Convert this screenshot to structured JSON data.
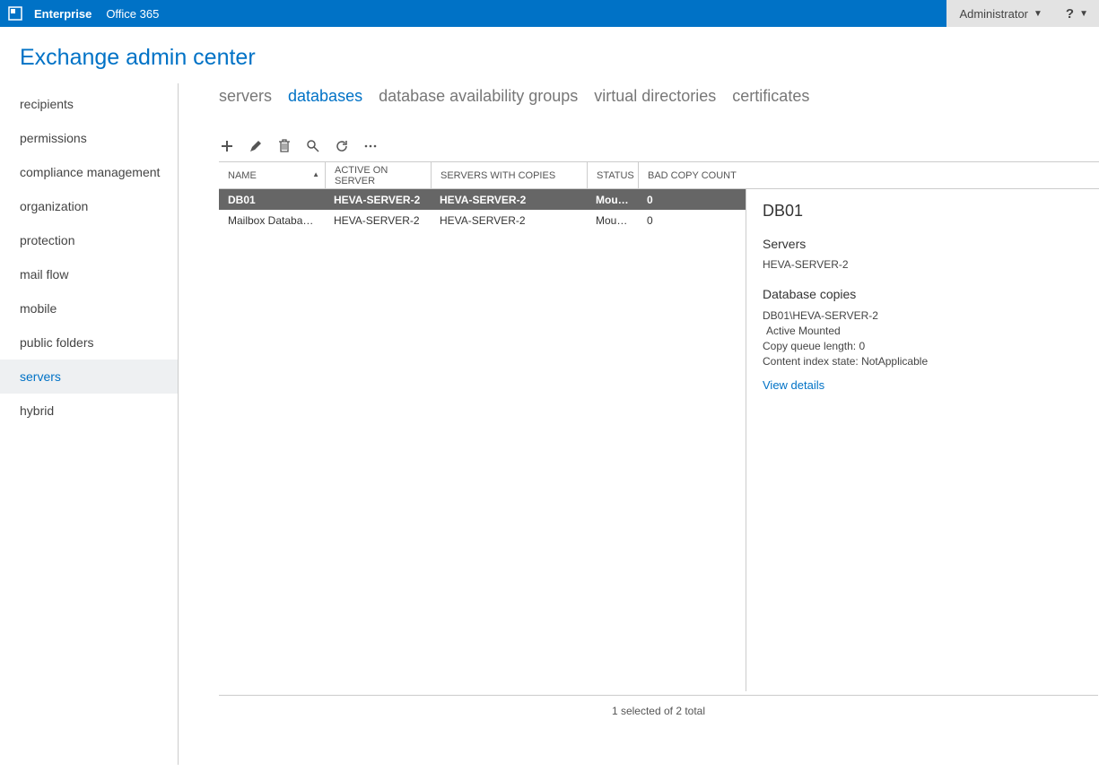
{
  "topbar": {
    "link_enterprise": "Enterprise",
    "link_office365": "Office 365",
    "user_label": "Administrator",
    "help_label": "?"
  },
  "page_title": "Exchange admin center",
  "sidebar": {
    "items": [
      {
        "label": "recipients"
      },
      {
        "label": "permissions"
      },
      {
        "label": "compliance management"
      },
      {
        "label": "organization"
      },
      {
        "label": "protection"
      },
      {
        "label": "mail flow"
      },
      {
        "label": "mobile"
      },
      {
        "label": "public folders"
      },
      {
        "label": "servers"
      },
      {
        "label": "hybrid"
      }
    ]
  },
  "tabs": [
    {
      "label": "servers"
    },
    {
      "label": "databases"
    },
    {
      "label": "database availability groups"
    },
    {
      "label": "virtual directories"
    },
    {
      "label": "certificates"
    }
  ],
  "grid": {
    "headers": {
      "name": "NAME",
      "active_on_server": "ACTIVE ON SERVER",
      "servers_with_copies": "SERVERS WITH COPIES",
      "status": "STATUS",
      "bad_copy_count": "BAD COPY COUNT"
    },
    "rows": [
      {
        "name": "DB01",
        "active_on_server": "HEVA-SERVER-2",
        "servers_with_copies": "HEVA-SERVER-2",
        "status": "Moun…",
        "bad_copy_count": "0"
      },
      {
        "name": "Mailbox Databas…",
        "active_on_server": "HEVA-SERVER-2",
        "servers_with_copies": "HEVA-SERVER-2",
        "status": "Moun…",
        "bad_copy_count": "0"
      }
    ]
  },
  "details": {
    "title": "DB01",
    "servers_heading": "Servers",
    "servers_value": "HEVA-SERVER-2",
    "copies_heading": "Database copies",
    "copy_path": "DB01\\HEVA-SERVER-2",
    "copy_state": "Active Mounted",
    "queue_label": "Copy queue length:",
    "queue_value": "0",
    "index_label": "Content index state:",
    "index_value": "NotApplicable",
    "view_details": "View details"
  },
  "footer_status": "1 selected of 2 total"
}
